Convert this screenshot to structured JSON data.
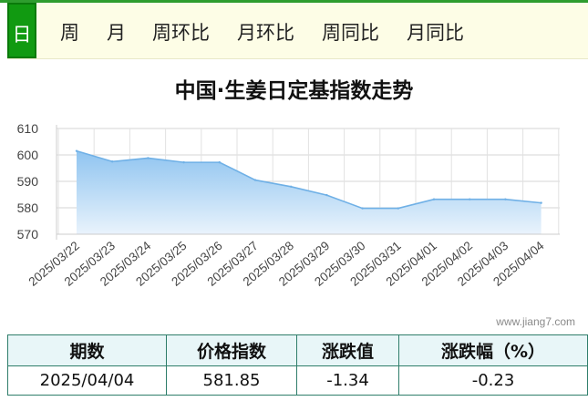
{
  "tabs": [
    {
      "label": "日",
      "active": true
    },
    {
      "label": "周",
      "active": false
    },
    {
      "label": "月",
      "active": false
    },
    {
      "label": "周环比",
      "active": false
    },
    {
      "label": "月环比",
      "active": false
    },
    {
      "label": "周同比",
      "active": false
    },
    {
      "label": "月同比",
      "active": false
    }
  ],
  "colors": {
    "accent": "#119a11",
    "line": "#6fb0e6",
    "fill": "#9fcdf2",
    "table_border": "#2e7d6a"
  },
  "chart_data": {
    "type": "area",
    "title": "中国·生姜日定基指数走势",
    "categories": [
      "2025/03/22",
      "2025/03/23",
      "2025/03/24",
      "2025/03/25",
      "2025/03/26",
      "2025/03/27",
      "2025/03/28",
      "2025/03/29",
      "2025/03/30",
      "2025/03/31",
      "2025/04/01",
      "2025/04/02",
      "2025/04/03",
      "2025/04/04"
    ],
    "series": [
      {
        "values": [
          601.5,
          597.5,
          598.8,
          597.2,
          597.2,
          590.5,
          588.0,
          584.8,
          579.8,
          579.8,
          583.2,
          583.2,
          583.2,
          581.85
        ]
      }
    ],
    "ylim": [
      570,
      610
    ],
    "yticks": [
      "570",
      "580",
      "590",
      "600",
      "610"
    ],
    "grid": true
  },
  "watermark": "www.jiang7.com",
  "table": {
    "headers": [
      "期数",
      "价格指数",
      "涨跌值",
      "涨跌幅（%）"
    ],
    "row": [
      "2025/04/04",
      "581.85",
      "-1.34",
      "-0.23"
    ]
  }
}
